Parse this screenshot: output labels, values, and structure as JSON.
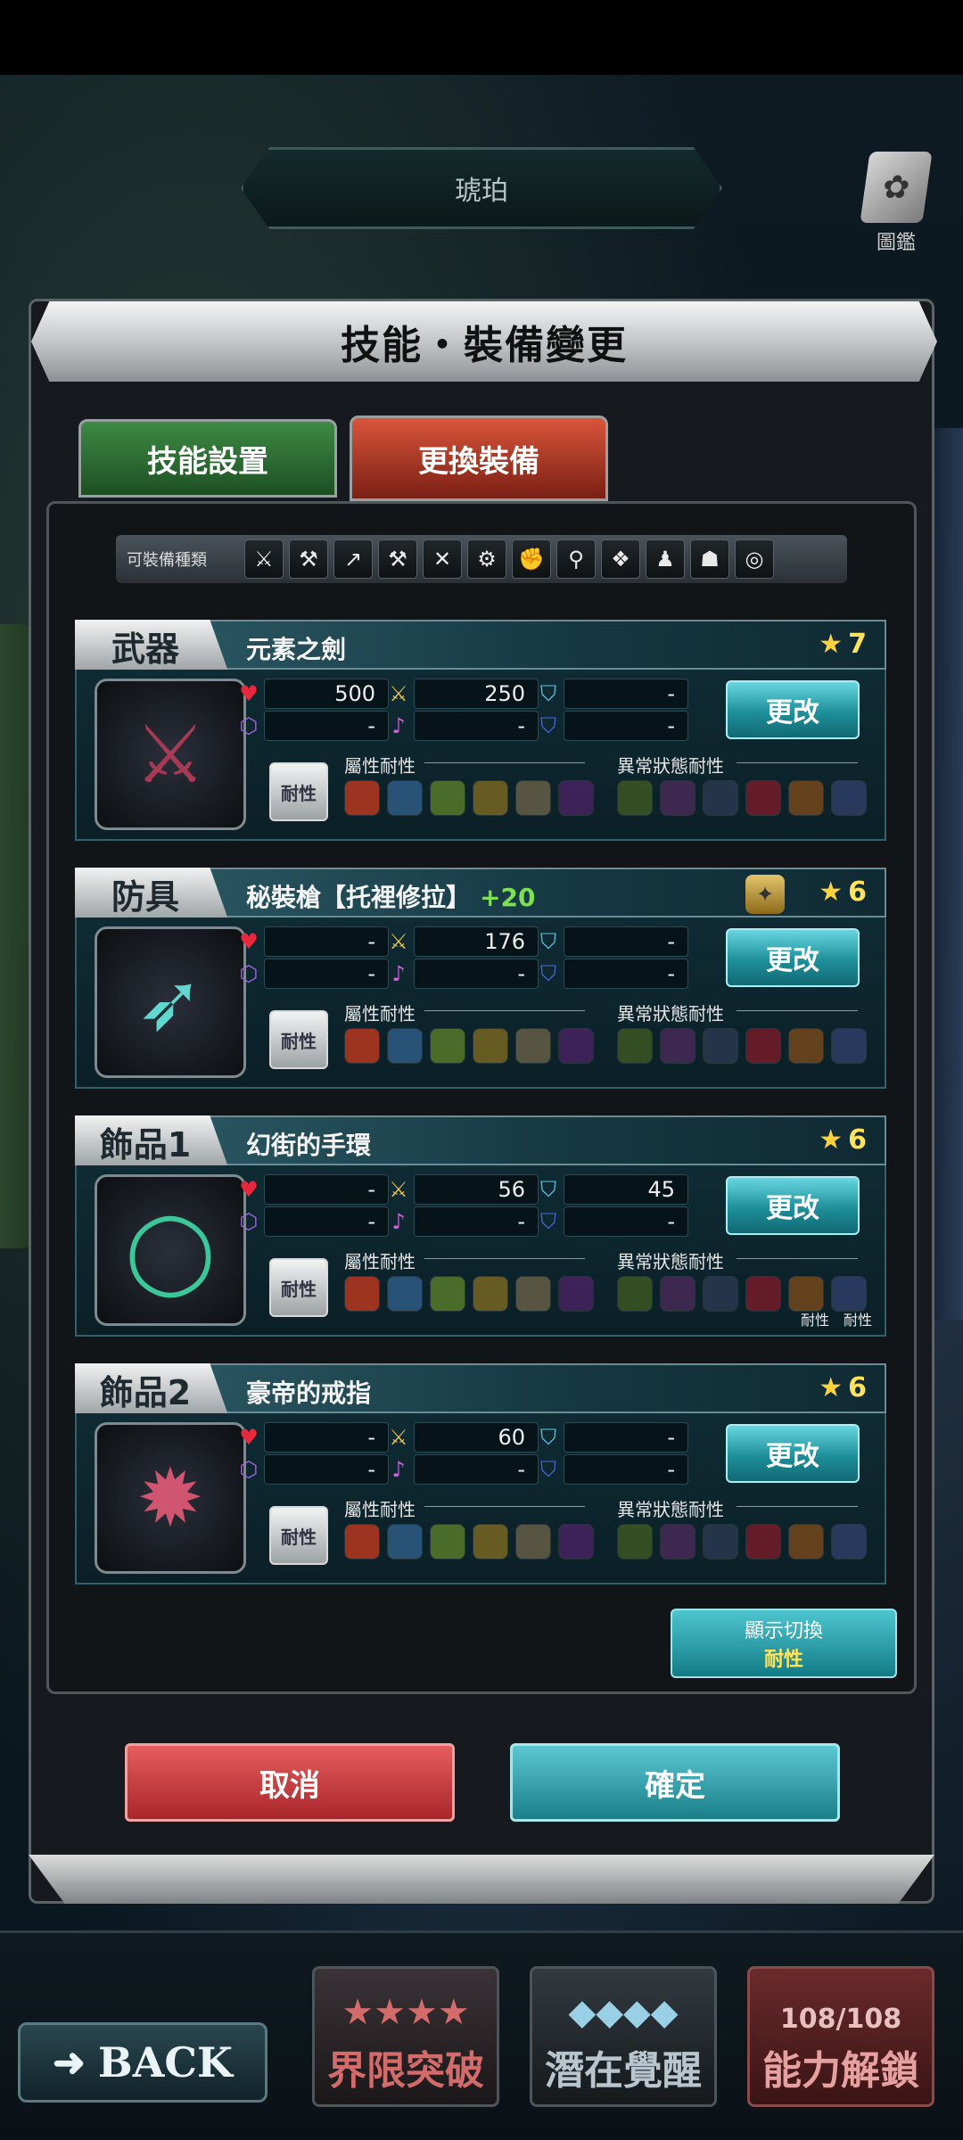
{
  "character_name": "琥珀",
  "book_label": "圖鑑",
  "dialog_title": "技能・裝備變更",
  "tabs": {
    "skill": "技能設置",
    "equip": "更換裝備"
  },
  "equip_types": {
    "label": "可裝備種類",
    "icons": [
      "sword-icon",
      "axe-icon",
      "spear-icon",
      "hammer-icon",
      "bow-icon",
      "gear-icon",
      "fist-icon",
      "staff-icon",
      "armor-icon",
      "shirt-icon",
      "helmet-icon",
      "ring-icon"
    ]
  },
  "labels": {
    "attr_resist": "屬性耐性",
    "status_resist": "異常狀態耐性",
    "resist_btn": "耐性",
    "change_btn": "更改"
  },
  "cards": [
    {
      "slot": "武器",
      "name": "元素之劍",
      "plus": "",
      "rarity": "7",
      "hp": "500",
      "atk": "250",
      "def": "-",
      "mag": "-",
      "matk": "-",
      "mdef": "-"
    },
    {
      "slot": "防具",
      "name": "秘裝槍【托裡修拉】",
      "plus": "+20",
      "rarity": "6",
      "hp": "-",
      "atk": "176",
      "def": "-",
      "mag": "-",
      "matk": "-",
      "mdef": "-"
    },
    {
      "slot": "飾品1",
      "name": "幻街的手環",
      "plus": "",
      "rarity": "6",
      "hp": "-",
      "atk": "56",
      "def": "45",
      "mag": "-",
      "matk": "-",
      "mdef": "-",
      "resist_tags": [
        "耐性",
        "耐性"
      ]
    },
    {
      "slot": "飾品2",
      "name": "豪帝的戒指",
      "plus": "",
      "rarity": "6",
      "hp": "-",
      "atk": "60",
      "def": "-",
      "mag": "-",
      "matk": "-",
      "mdef": "-"
    }
  ],
  "toggle": {
    "line1": "顯示切換",
    "line2": "耐性"
  },
  "cancel_label": "取消",
  "confirm_label": "確定",
  "back_label": "BACK",
  "menu": {
    "limit_break": "界限突破",
    "awaken": "潛在覺醒",
    "unlock": "能力解鎖",
    "unlock_count": "108/108"
  },
  "colors": {
    "accent": "#1e8f9a",
    "cancel": "#a8262b",
    "tab_active": "#d9553a",
    "tab_inactive": "#3e8a45"
  }
}
